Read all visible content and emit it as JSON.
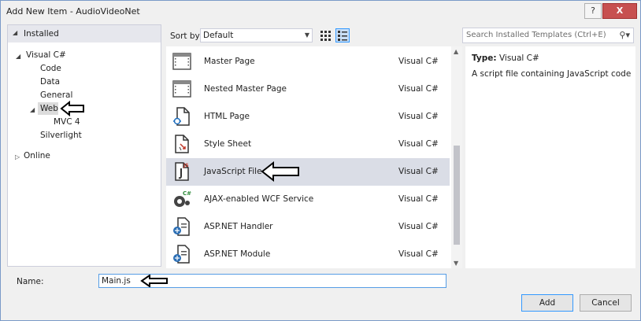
{
  "window": {
    "title": "Add New Item - AudioVideoNet",
    "help_label": "?",
    "close_label": "X"
  },
  "left_pane": {
    "installed_label": "Installed",
    "tree": [
      {
        "label": "Visual C#",
        "expander": "◢"
      },
      {
        "label": "Code"
      },
      {
        "label": "Data"
      },
      {
        "label": "General"
      },
      {
        "label": "Web",
        "expander": "◢",
        "selected": true
      },
      {
        "label": "MVC 4"
      },
      {
        "label": "Silverlight"
      },
      {
        "label": "Online",
        "expander": "▷"
      }
    ]
  },
  "toolbar": {
    "sort_label": "Sort by:",
    "sort_value": "Default",
    "search_placeholder": "Search Installed Templates (Ctrl+E)"
  },
  "templates": [
    {
      "name": "Master Page",
      "lang": "Visual C#",
      "icon": "master-page-icon"
    },
    {
      "name": "Nested Master Page",
      "lang": "Visual C#",
      "icon": "nested-master-page-icon"
    },
    {
      "name": "HTML Page",
      "lang": "Visual C#",
      "icon": "html-page-icon"
    },
    {
      "name": "Style Sheet",
      "lang": "Visual C#",
      "icon": "style-sheet-icon"
    },
    {
      "name": "JavaScript File",
      "lang": "Visual C#",
      "icon": "javascript-file-icon",
      "selected": true
    },
    {
      "name": "AJAX-enabled WCF Service",
      "lang": "Visual C#",
      "icon": "wcf-service-icon"
    },
    {
      "name": "ASP.NET Handler",
      "lang": "Visual C#",
      "icon": "aspnet-handler-icon"
    },
    {
      "name": "ASP.NET Module",
      "lang": "Visual C#",
      "icon": "aspnet-module-icon"
    }
  ],
  "details": {
    "type_label": "Type:",
    "type_value": "Visual C#",
    "description": "A script file containing JavaScript code"
  },
  "name_field": {
    "label": "Name:",
    "value": "Main.js"
  },
  "buttons": {
    "add": "Add",
    "cancel": "Cancel"
  },
  "colors": {
    "selection": "#dadde6",
    "accent": "#3399ff",
    "close": "#c75050"
  }
}
